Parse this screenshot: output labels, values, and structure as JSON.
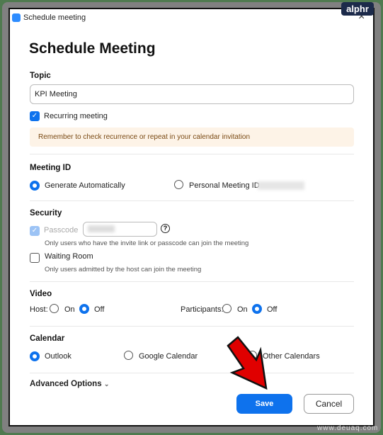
{
  "window": {
    "title": "Schedule meeting",
    "close": "×"
  },
  "heading": "Schedule Meeting",
  "topic": {
    "label": "Topic",
    "value": "KPI Meeting"
  },
  "recurring": {
    "label": "Recurring meeting",
    "checked": true
  },
  "notice": "Remember to check recurrence or repeat in your calendar invitation",
  "meeting_id": {
    "label": "Meeting ID",
    "options": [
      "Generate Automatically",
      "Personal Meeting ID"
    ],
    "selected": "Generate Automatically"
  },
  "security": {
    "label": "Security",
    "passcode_label": "Passcode",
    "passcode_help": "?",
    "passcode_desc": "Only users who have the invite link or passcode can join the meeting",
    "waiting_label": "Waiting Room",
    "waiting_desc": "Only users admitted by the host can join the meeting"
  },
  "video": {
    "label": "Video",
    "host_label": "Host:",
    "participants_label": "Participants:",
    "on": "On",
    "off": "Off",
    "host": "Off",
    "participants": "Off"
  },
  "calendar": {
    "label": "Calendar",
    "options": [
      "Outlook",
      "Google Calendar",
      "Other Calendars"
    ],
    "selected": "Outlook"
  },
  "advanced": "Advanced Options",
  "buttons": {
    "save": "Save",
    "cancel": "Cancel"
  },
  "watermarks": {
    "brand": "alphr",
    "site": "www.deuaq.com"
  },
  "colors": {
    "accent": "#0e72ed",
    "notice_bg": "#fdf3e7",
    "arrow": "#e00000"
  }
}
